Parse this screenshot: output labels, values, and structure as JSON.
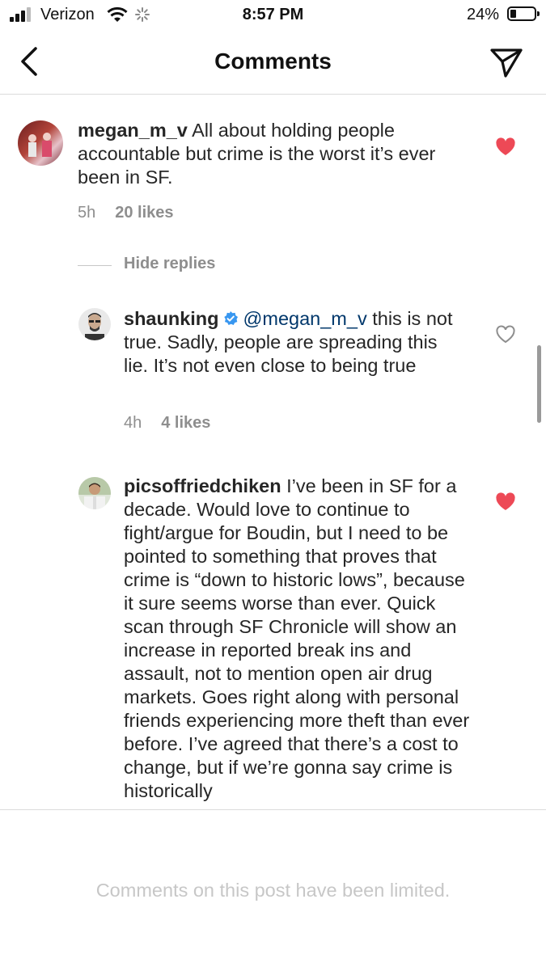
{
  "status_bar": {
    "carrier": "Verizon",
    "time": "8:57 PM",
    "battery": "24%",
    "battery_level": 0.24,
    "signal_bars": 3
  },
  "nav": {
    "title": "Comments",
    "back_icon": "chevron-left-icon",
    "send_icon": "paper-plane-icon"
  },
  "comments": [
    {
      "username": "megan_m_v",
      "text": "All about holding people accountable but crime is the worst it’s ever been in SF.",
      "time": "5h",
      "likes": "20 likes",
      "liked": true
    }
  ],
  "hide_replies_label": "Hide replies",
  "replies": [
    {
      "username": "shaunking",
      "verified": true,
      "mention": "@megan_m_v",
      "text": "this is not true. Sadly, people are spreading this lie. It’s not even close to being true",
      "time": "4h",
      "likes": "4 likes",
      "liked": false
    },
    {
      "username": "picsoffriedchiken",
      "text": "I’ve been in SF for a decade. Would love to continue to fight/argue for Boudin, but I need to be pointed to something that proves that crime is “down to historic lows”, because it sure seems worse than ever. Quick scan through SF Chronicle will show an increase in reported break ins and assault, not to mention open air drug markets. Goes right along with personal friends experiencing more theft than ever before. I’ve agreed that there’s a cost to change, but if we’re gonna say crime is historically",
      "liked": true
    }
  ],
  "footer": {
    "limited_text": "Comments on this post have been limited."
  },
  "colors": {
    "heart_liked": "#ed4956",
    "heart_outline": "#8e8e8e",
    "secondary_text": "#8e8e8e",
    "mention": "#00376b",
    "verified_badge": "#3897f0"
  }
}
